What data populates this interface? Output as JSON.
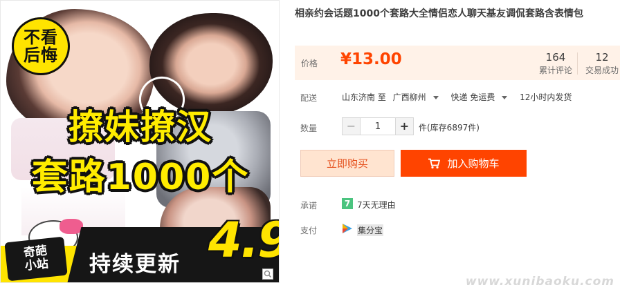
{
  "image": {
    "badge_line1": "不看",
    "badge_line2": "后悔",
    "headline_line1": "撩妹撩汉",
    "headline_line2": "套路1000个",
    "corner_line1": "奇葩",
    "corner_line2": "小站",
    "update_text": "持续更新",
    "rating": "4.9",
    "icon": "zoom-icon"
  },
  "product": {
    "title": "相亲约会话题1000个套路大全情侣恋人聊天基友调侃套路含表情包"
  },
  "price": {
    "label": "价格",
    "value": "¥13.00",
    "color": "#ff4400"
  },
  "stats": {
    "reviews_count": "164",
    "reviews_label": "累计评论",
    "deals_count": "12",
    "deals_label": "交易成功"
  },
  "shipping": {
    "label": "配送",
    "origin": "山东济南 至",
    "destination": "广西柳州",
    "method": "快递 免运费",
    "dispatch": "12小时内发货"
  },
  "quantity": {
    "label": "数量",
    "minus": "−",
    "value": "1",
    "plus": "+",
    "stock": "件(库存6897件)"
  },
  "actions": {
    "buy_now": "立即购买",
    "add_to_cart": "加入购物车",
    "cart_icon": "cart-icon"
  },
  "promise": {
    "label": "承诺",
    "icon_char": "7",
    "text": "7天无理由"
  },
  "payment": {
    "label": "支付",
    "text": "集分宝"
  },
  "watermark": "www.xunibaoku.com"
}
